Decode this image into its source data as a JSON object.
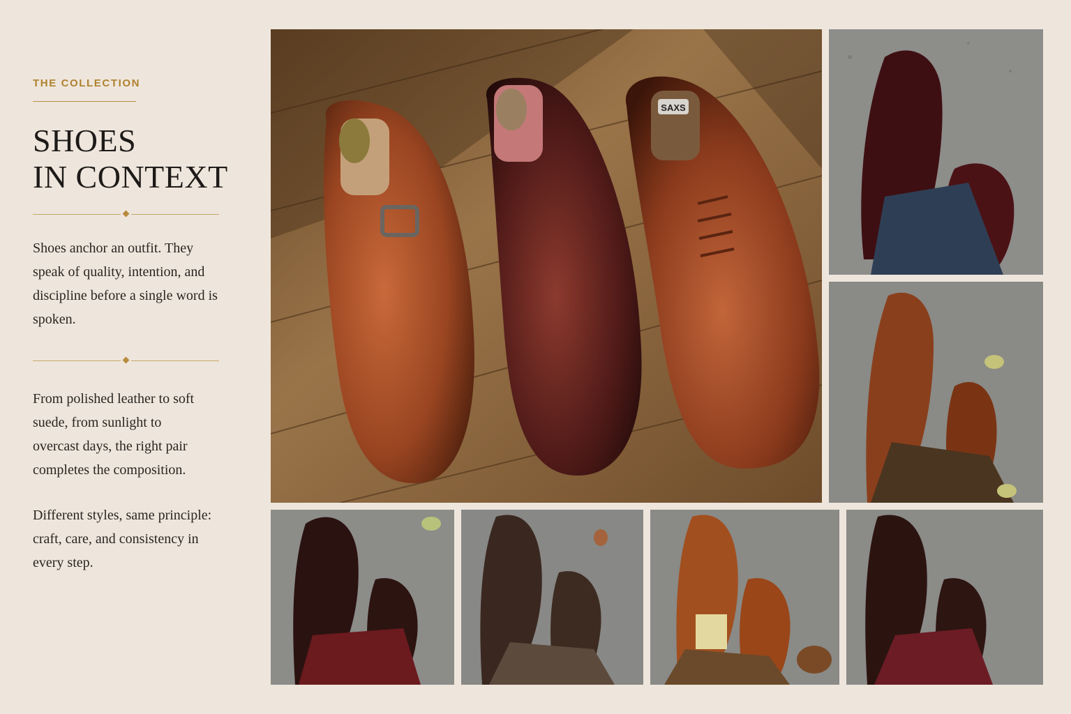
{
  "sidebar": {
    "eyebrow": "THE COLLECTION",
    "title_line1": "SHOES",
    "title_line2": "IN CONTEXT",
    "intro": "Shoes anchor an outfit. They speak of quality, intention, and discipline before a single word is spoken.",
    "body1": "From polished leather to soft suede, from sunlight to overcast days, the right pair completes the composition.",
    "body2": "Different styles, same principle: craft, care, and consistency in every step."
  },
  "gallery": {
    "hero": {
      "subject": "three shoes on wooden floor with shoe trees",
      "tree_label": "SAXS"
    },
    "tiles": [
      {
        "subject": "burgundy brogue boots with navy trousers"
      },
      {
        "subject": "brown monk strap shoes with brown trousers"
      },
      {
        "subject": "dark brown derby shoes with red corduroy trousers"
      },
      {
        "subject": "brown suede chukka boots with patterned trousers"
      },
      {
        "subject": "tan brogues with yellow socks and brown trousers"
      },
      {
        "subject": "dark brown cap-toe shoes with burgundy trousers"
      }
    ]
  },
  "colors": {
    "background": "#eee6dc",
    "accent": "#b0812f",
    "text": "#2a2522"
  }
}
